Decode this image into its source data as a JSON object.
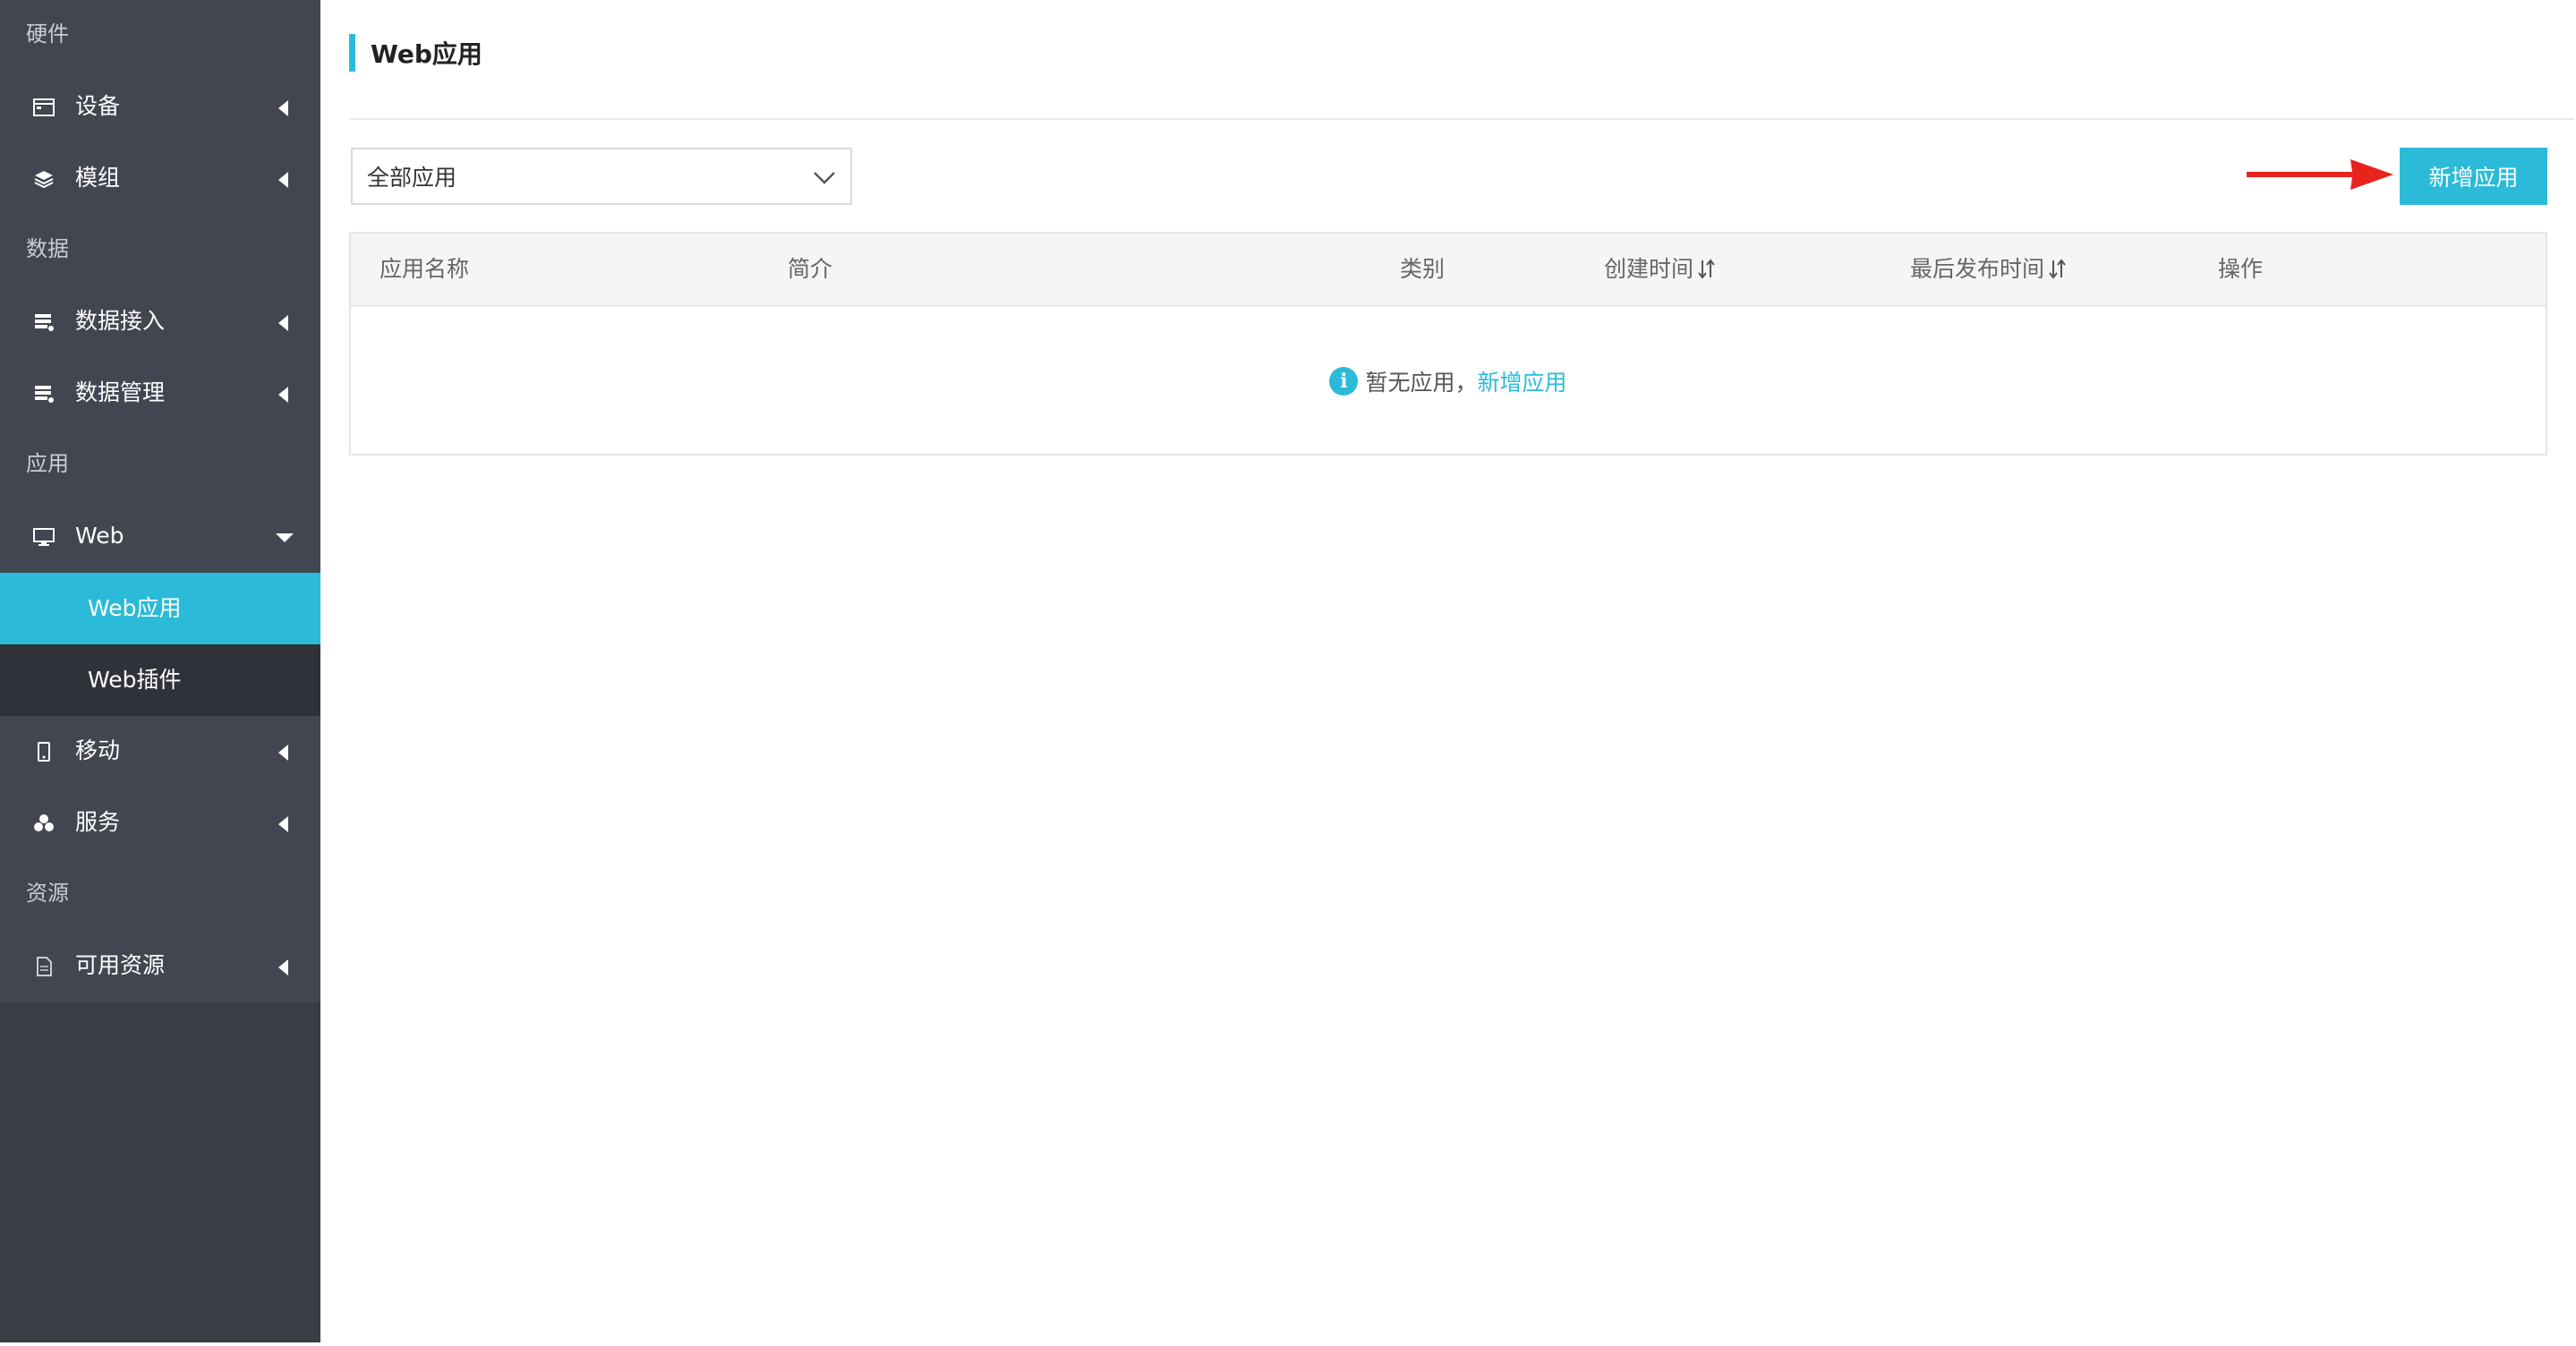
{
  "sidebar": {
    "sections": {
      "hardware": "硬件",
      "data": "数据",
      "app": "应用",
      "resources": "资源"
    },
    "items": {
      "device": "设备",
      "module": "模组",
      "data_access": "数据接入",
      "data_manage": "数据管理",
      "web": "Web",
      "web_app": "Web应用",
      "web_plugin": "Web插件",
      "mobile": "移动",
      "service": "服务",
      "available_resources": "可用资源"
    },
    "active_item": "Web应用"
  },
  "header": {
    "title": "Web应用"
  },
  "filter": {
    "selected": "全部应用"
  },
  "toolbar": {
    "add_label": "新增应用"
  },
  "table": {
    "columns": {
      "name": "应用名称",
      "desc": "简介",
      "category": "类别",
      "created": "创建时间",
      "published": "最后发布时间",
      "actions": "操作"
    },
    "empty_text": "暂无应用，",
    "empty_link": "新增应用"
  },
  "colors": {
    "accent": "#2bbbd8",
    "sidebar_bg": "#424651",
    "annotation_arrow": "#e8231b"
  }
}
